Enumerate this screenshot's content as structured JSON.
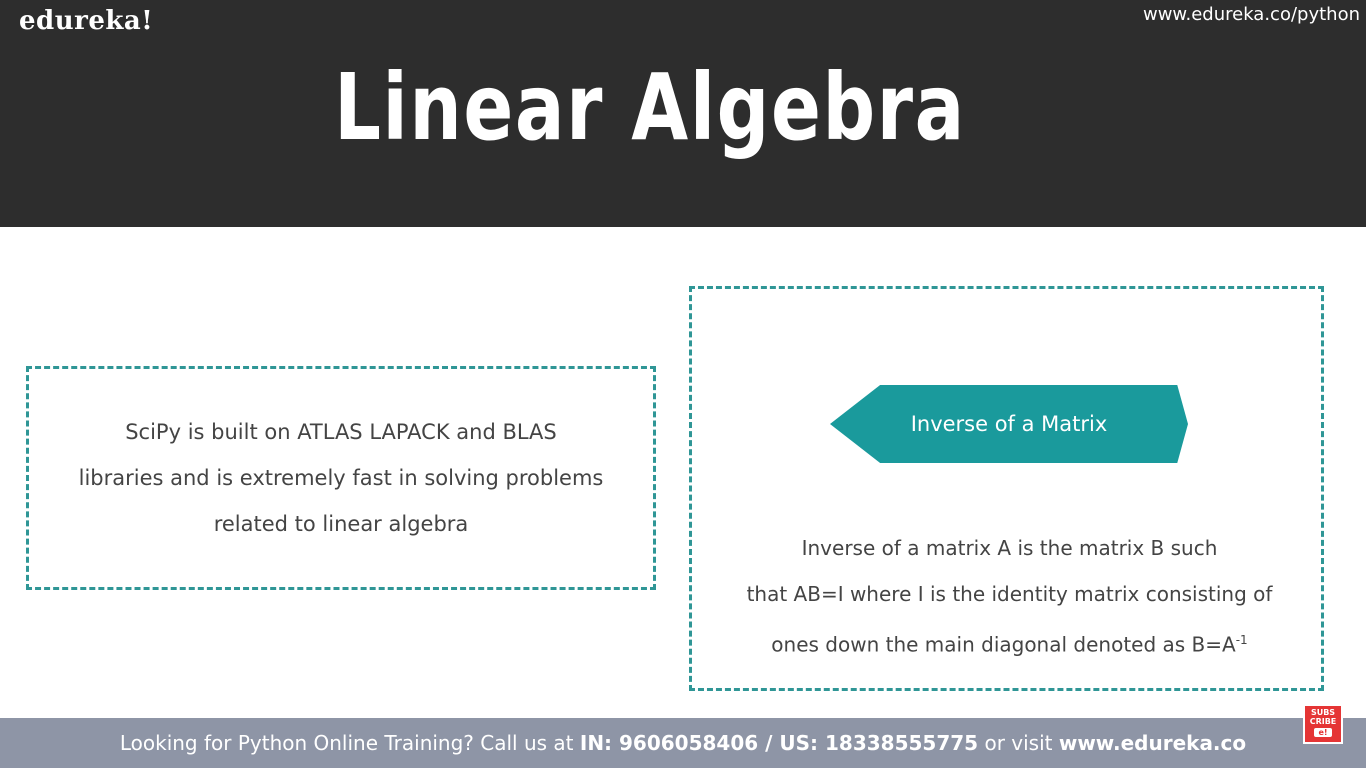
{
  "header": {
    "logo": "edureka!",
    "site_url": "www.edureka.co/python",
    "title": "Linear Algebra"
  },
  "left_panel": {
    "lines": [
      "SciPy is built on  ATLAS LAPACK and BLAS",
      "libraries and is extremely fast in solving problems",
      "related to linear algebra"
    ]
  },
  "right_panel": {
    "banner": "Inverse of a Matrix",
    "line1": "Inverse of a matrix A is the matrix B such",
    "line2": "that AB=I where I is the identity matrix consisting of",
    "line3": "ones down the main diagonal denoted as B=A",
    "line3_sup": "-1"
  },
  "footer": {
    "prefix": "Looking for Python Online Training? Call us at ",
    "phone_label": "IN: 9606058406 / US: 18338555775",
    "middle": " or visit ",
    "site": "www.edureka.co"
  },
  "subscribe": {
    "line1": "SUBS",
    "line2": "CRIBE",
    "badge": "e!"
  },
  "colors": {
    "header_bg": "#2d2d2d",
    "accent_teal": "#1a9a9c",
    "dashed_border": "#2f9696",
    "footer_bg": "#8e95a6",
    "subscribe_red": "#e53535"
  }
}
